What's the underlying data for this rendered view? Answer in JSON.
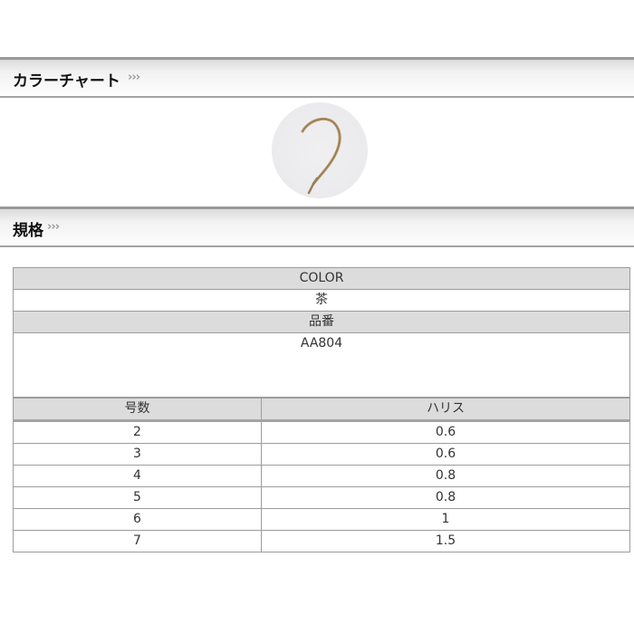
{
  "sections": {
    "color_chart": {
      "title": "カラーチャート",
      "chevrons": "›››"
    },
    "spec": {
      "title": "規格",
      "chevrons": "›››"
    }
  },
  "swatch": {
    "icon": "fishing-hook-icon",
    "hook_color": "#a88a5c",
    "background": "#ebeaec"
  },
  "spec_table": {
    "color_label": "COLOR",
    "color_value": "茶",
    "part_number_label": "品番",
    "part_number_value": "AA804"
  },
  "size_table": {
    "columns": [
      "号数",
      "ハリス"
    ],
    "rows": [
      [
        "2",
        "0.6"
      ],
      [
        "3",
        "0.6"
      ],
      [
        "4",
        "0.8"
      ],
      [
        "5",
        "0.8"
      ],
      [
        "6",
        "1"
      ],
      [
        "7",
        "1.5"
      ]
    ]
  }
}
